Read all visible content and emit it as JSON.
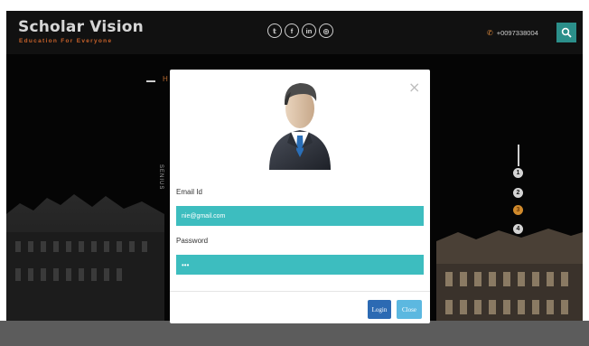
{
  "header": {
    "brand_title": "Scholar Vision",
    "brand_tagline": "Education For Everyone",
    "socials": [
      {
        "icon": "twitter-icon",
        "glyph": "𝕥"
      },
      {
        "icon": "facebook-icon",
        "glyph": "f"
      },
      {
        "icon": "linkedin-icon",
        "glyph": "in"
      },
      {
        "icon": "dribbble-icon",
        "glyph": "◎"
      }
    ],
    "phone": "+0097338004",
    "accent_color": "#2b8f8a"
  },
  "background": {
    "hero_letter": "H",
    "vertical_text": "SENIUS",
    "slider_dots": [
      "1",
      "2",
      "3",
      "4"
    ],
    "active_dot_index": 2
  },
  "modal": {
    "email_label": "Email Id",
    "email_value": "nie@gmail.com",
    "password_label": "Password",
    "password_value": "•••",
    "login_label": "Login",
    "close_label": "Close",
    "close_glyph": "×",
    "input_color": "#3dbdbf",
    "login_color": "#2c6ab3",
    "close_color": "#5cb8e0"
  }
}
